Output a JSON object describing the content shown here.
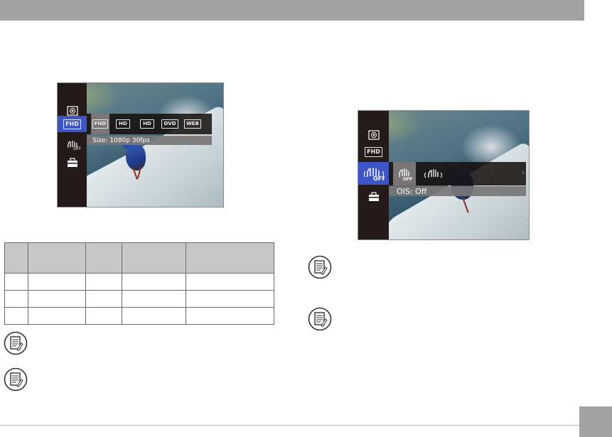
{
  "left_screen": {
    "sidebar_icons": [
      "exposure-icon",
      "fhd-icon",
      "ois-off-icon",
      "toolbox-icon"
    ],
    "active_sidebar_label": "FHD",
    "options": [
      "FHD",
      "HD",
      "HD",
      "DVD",
      "WEB"
    ],
    "selected_option_index": 0,
    "caption": "Size: 1080p 30fps"
  },
  "right_screen": {
    "sidebar_icons": [
      "exposure-icon",
      "fhd-icon",
      "ois-off-icon",
      "toolbox-icon"
    ],
    "sidebar_fhd_label": "FHD",
    "options": [
      "ois-off-icon",
      "ois-on-icon"
    ],
    "selected_option_index": 0,
    "caption": "OIS: Off"
  },
  "table": {
    "header_row_count": 1,
    "body_row_count": 3,
    "column_count": 5
  },
  "notes": [
    "note-icon",
    "note-icon",
    "note-icon",
    "note-icon"
  ]
}
